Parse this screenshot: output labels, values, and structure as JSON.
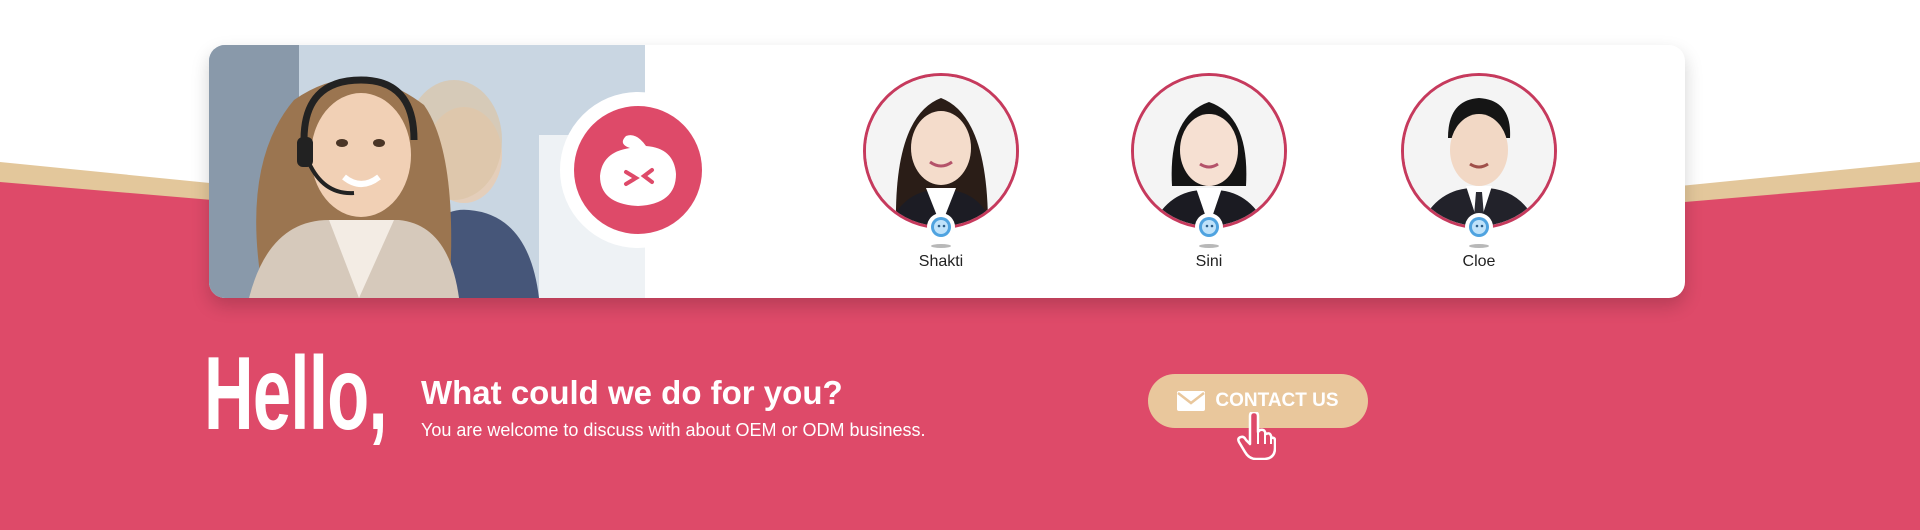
{
  "colors": {
    "brand_pink": "#de4a69",
    "beige": "#e3c79b",
    "card_bg": "#ffffff",
    "ring": "#c63a5d"
  },
  "banner": {
    "photo_icon": "customer-service-photo",
    "brand_icon": "chat-bubble-logo-icon"
  },
  "agents": [
    {
      "name": "Shakti",
      "icon": "chat-badge-icon"
    },
    {
      "name": "Sini",
      "icon": "chat-badge-icon"
    },
    {
      "name": "Cloe",
      "icon": "chat-badge-icon"
    }
  ],
  "cta": {
    "hello": "Hello,",
    "headline": "What could we do for you?",
    "subline": "You are welcome to discuss with about OEM or ODM business.",
    "button_label": "CONTACT US",
    "button_icon": "envelope-icon",
    "cursor_icon": "hand-pointer-icon"
  }
}
